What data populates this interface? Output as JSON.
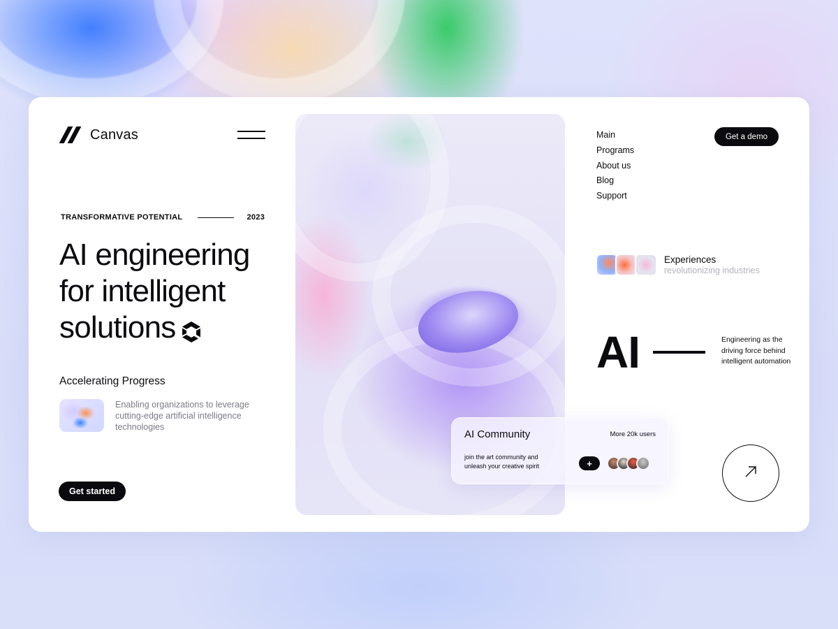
{
  "brand": {
    "name": "Canvas"
  },
  "eyebrow": {
    "label": "TRANSFORMATIVE POTENTIAL",
    "year": "2023"
  },
  "headline": {
    "line1": "AI engineering",
    "line2": "for intelligent",
    "line3": "solutions"
  },
  "feature": {
    "title": "Accelerating Progress",
    "text": "Enabling organizations to leverage cutting-edge artificial intelligence technologies"
  },
  "cta": {
    "get_started": "Get started",
    "get_demo": "Get a demo"
  },
  "nav": {
    "items": [
      "Main",
      "Programs",
      "About us",
      "Blog",
      "Support"
    ]
  },
  "experiences": {
    "title": "Experiences",
    "subtitle": "revolutionizing industries"
  },
  "ai_block": {
    "big": "AI",
    "note": "Engineering as the driving force behind intelligent automation"
  },
  "community": {
    "title": "AI Community",
    "count": "More 20k users",
    "text": "join the art community and unleash your creative spirit",
    "plus": "+"
  },
  "icons": [
    "brand-slashes-icon",
    "menu-icon",
    "hexagon-logo-icon",
    "plus-icon",
    "arrow-up-right-icon"
  ],
  "colors": {
    "ink": "#0b0b0f",
    "muted": "#7b7c86",
    "card": "#ffffff",
    "accent_purple": "#9c88f0"
  }
}
